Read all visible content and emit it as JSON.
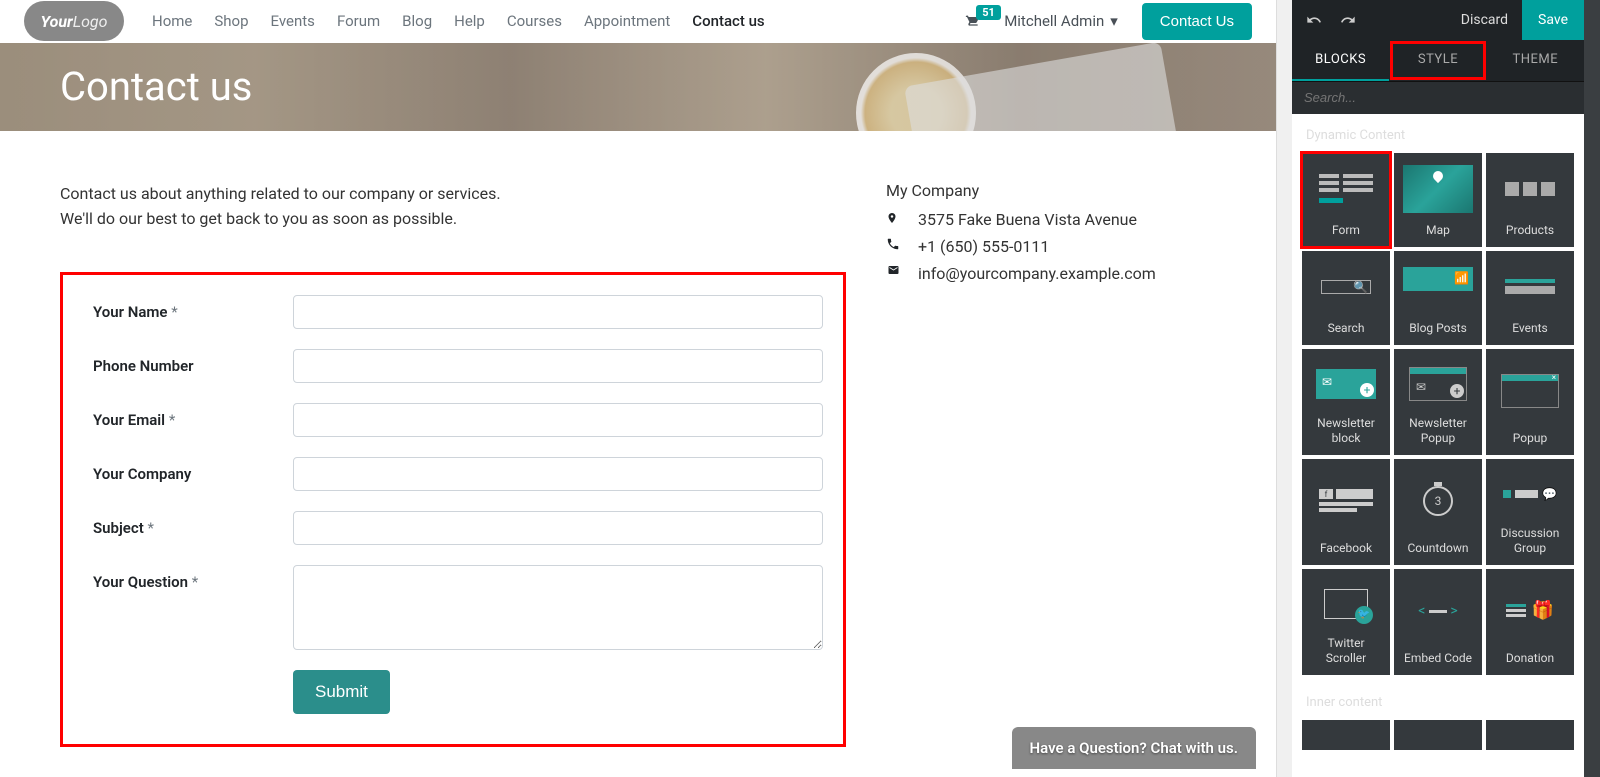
{
  "nav": {
    "logo_main": "Your",
    "logo_sub": "Logo",
    "links": [
      "Home",
      "Shop",
      "Events",
      "Forum",
      "Blog",
      "Help",
      "Courses",
      "Appointment",
      "Contact us"
    ],
    "active_index": 8,
    "cart_count": "51",
    "user": "Mitchell Admin",
    "contact_btn": "Contact Us"
  },
  "hero": {
    "title": "Contact us"
  },
  "intro": {
    "line1": "Contact us about anything related to our company or services.",
    "line2": "We'll do our best to get back to you as soon as possible."
  },
  "form": {
    "fields": [
      {
        "label": "Your Name",
        "required": true,
        "type": "text"
      },
      {
        "label": "Phone Number",
        "required": false,
        "type": "text"
      },
      {
        "label": "Your Email",
        "required": true,
        "type": "text"
      },
      {
        "label": "Your Company",
        "required": false,
        "type": "text"
      },
      {
        "label": "Subject",
        "required": true,
        "type": "text"
      },
      {
        "label": "Your Question",
        "required": true,
        "type": "textarea"
      }
    ],
    "submit": "Submit"
  },
  "company": {
    "name": "My Company",
    "address": "3575 Fake Buena Vista Avenue",
    "phone": "+1 (650) 555-0111",
    "email": "info@yourcompany.example.com"
  },
  "chat": {
    "text": "Have a Question? Chat with us."
  },
  "panel": {
    "discard": "Discard",
    "save": "Save",
    "tabs": [
      "BLOCKS",
      "STYLE",
      "THEME"
    ],
    "active_tab": 0,
    "highlight_tab": 1,
    "search_placeholder": "Search...",
    "section1": "Dynamic Content",
    "section2": "Inner content",
    "blocks": [
      {
        "label": "Form",
        "highlight": true
      },
      {
        "label": "Map"
      },
      {
        "label": "Products"
      },
      {
        "label": "Search"
      },
      {
        "label": "Blog Posts"
      },
      {
        "label": "Events"
      },
      {
        "label": "Newsletter block"
      },
      {
        "label": "Newsletter Popup"
      },
      {
        "label": "Popup"
      },
      {
        "label": "Facebook"
      },
      {
        "label": "Countdown"
      },
      {
        "label": "Discussion Group"
      },
      {
        "label": "Twitter Scroller"
      },
      {
        "label": "Embed Code"
      },
      {
        "label": "Donation"
      }
    ]
  }
}
